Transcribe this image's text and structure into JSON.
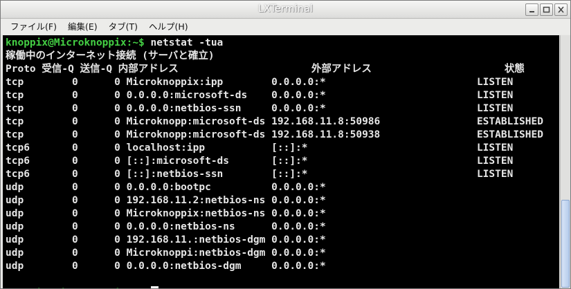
{
  "window": {
    "title": "LXTerminal",
    "buttons": {
      "minimize": "minimize",
      "maximize": "maximize",
      "close": "close"
    }
  },
  "menubar": {
    "items": [
      {
        "label": "ファイル(F)"
      },
      {
        "label": "編集(E)"
      },
      {
        "label": "タブ(T)"
      },
      {
        "label": "ヘルプ(H)"
      }
    ]
  },
  "terminal": {
    "prompt": "knoppix@Microknoppix:~$",
    "command": " netstat -tua",
    "header_line": "稼働中のインターネット接続 (サーバと確立)",
    "columns": [
      "Proto",
      "受信-Q",
      "送信-Q",
      "内部アドレス",
      "外部アドレス",
      "状態"
    ],
    "rows": [
      [
        "tcp",
        "0",
        "0",
        "Microknoppix:ipp",
        "0.0.0.0:*",
        "LISTEN"
      ],
      [
        "tcp",
        "0",
        "0",
        "0.0.0.0:microsoft-ds",
        "0.0.0.0:*",
        "LISTEN"
      ],
      [
        "tcp",
        "0",
        "0",
        "0.0.0.0:netbios-ssn",
        "0.0.0.0:*",
        "LISTEN"
      ],
      [
        "tcp",
        "0",
        "0",
        "Microknopp:microsoft-ds",
        "192.168.11.8:50986",
        "ESTABLISHED"
      ],
      [
        "tcp",
        "0",
        "0",
        "Microknopp:microsoft-ds",
        "192.168.11.8:50938",
        "ESTABLISHED"
      ],
      [
        "tcp6",
        "0",
        "0",
        "localhost:ipp",
        "[::]:*",
        "LISTEN"
      ],
      [
        "tcp6",
        "0",
        "0",
        "[::]:microsoft-ds",
        "[::]:*",
        "LISTEN"
      ],
      [
        "tcp6",
        "0",
        "0",
        "[::]:netbios-ssn",
        "[::]:*",
        "LISTEN"
      ],
      [
        "udp",
        "0",
        "0",
        "0.0.0.0:bootpc",
        "0.0.0.0:*",
        ""
      ],
      [
        "udp",
        "0",
        "0",
        "192.168.11.2:netbios-ns",
        "0.0.0.0:*",
        ""
      ],
      [
        "udp",
        "0",
        "0",
        "Microknoppix:netbios-ns",
        "0.0.0.0:*",
        ""
      ],
      [
        "udp",
        "0",
        "0",
        "0.0.0.0:netbios-ns",
        "0.0.0.0:*",
        ""
      ],
      [
        "udp",
        "0",
        "0",
        "192.168.11.:netbios-dgm",
        "0.0.0.0:*",
        ""
      ],
      [
        "udp",
        "0",
        "0",
        "Microknoppi:netbios-dgm",
        "0.0.0.0:*",
        ""
      ],
      [
        "udp",
        "0",
        "0",
        "0.0.0.0:netbios-dgm",
        "0.0.0.0:*",
        ""
      ]
    ],
    "prompt_color": "#44d044",
    "text_color": "#e6e6e6",
    "background_color": "#000000"
  }
}
